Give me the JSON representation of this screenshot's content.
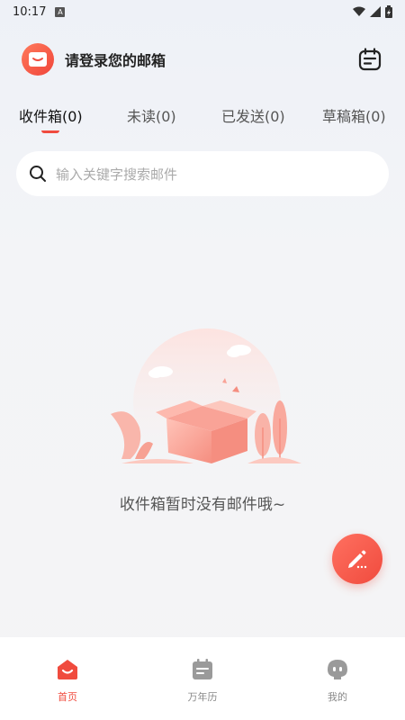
{
  "status_bar": {
    "time": "10:17",
    "a_icon_label": "A"
  },
  "header": {
    "title": "请登录您的邮箱"
  },
  "tabs": [
    {
      "label": "收件箱(0)",
      "active": true
    },
    {
      "label": "未读(0)",
      "active": false
    },
    {
      "label": "已发送(0)",
      "active": false
    },
    {
      "label": "草稿箱(0)",
      "active": false
    }
  ],
  "search": {
    "placeholder": "输入关键字搜索邮件"
  },
  "empty_state": {
    "text": "收件箱暂时没有邮件哦~"
  },
  "bottom_nav": [
    {
      "label": "首页",
      "icon": "home-icon",
      "active": true
    },
    {
      "label": "万年历",
      "icon": "calendar-icon",
      "active": false
    },
    {
      "label": "我的",
      "icon": "profile-icon",
      "active": false
    }
  ],
  "colors": {
    "accent": "#f04b3e",
    "accent_light": "#ff7a5c"
  }
}
